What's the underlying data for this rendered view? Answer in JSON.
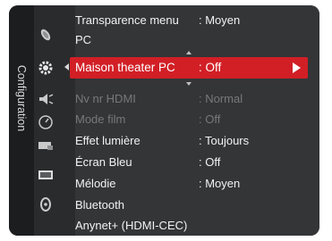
{
  "sidebar": {
    "label": "Configuration"
  },
  "icons": [
    "satellite-icon",
    "settings-icon",
    "sound-icon",
    "clock-icon",
    "input-icon",
    "picture-icon",
    "support-icon"
  ],
  "menu": {
    "items": [
      {
        "label": "Transparence menu",
        "value": ": Moyen",
        "state": "normal"
      },
      {
        "label": "PC",
        "value": "",
        "state": "normal"
      },
      {
        "label": "Maison theater PC",
        "value": ": Off",
        "state": "selected"
      },
      {
        "label": "Nv nr HDMI",
        "value": ": Normal",
        "state": "disabled"
      },
      {
        "label": "Mode film",
        "value": ": Off",
        "state": "disabled"
      },
      {
        "label": "Effet lumière",
        "value": ": Toujours",
        "state": "normal"
      },
      {
        "label": "Écran Bleu",
        "value": ": Off",
        "state": "normal"
      },
      {
        "label": "Mélodie",
        "value": ": Moyen",
        "state": "normal"
      },
      {
        "label": "Bluetooth",
        "value": "",
        "state": "normal"
      },
      {
        "label": "Anynet+ (HDMI-CEC)",
        "value": "",
        "state": "normal"
      }
    ]
  },
  "colors": {
    "highlight": "#d21f26",
    "panel": "#343537",
    "disabled_text": "#76787b"
  }
}
